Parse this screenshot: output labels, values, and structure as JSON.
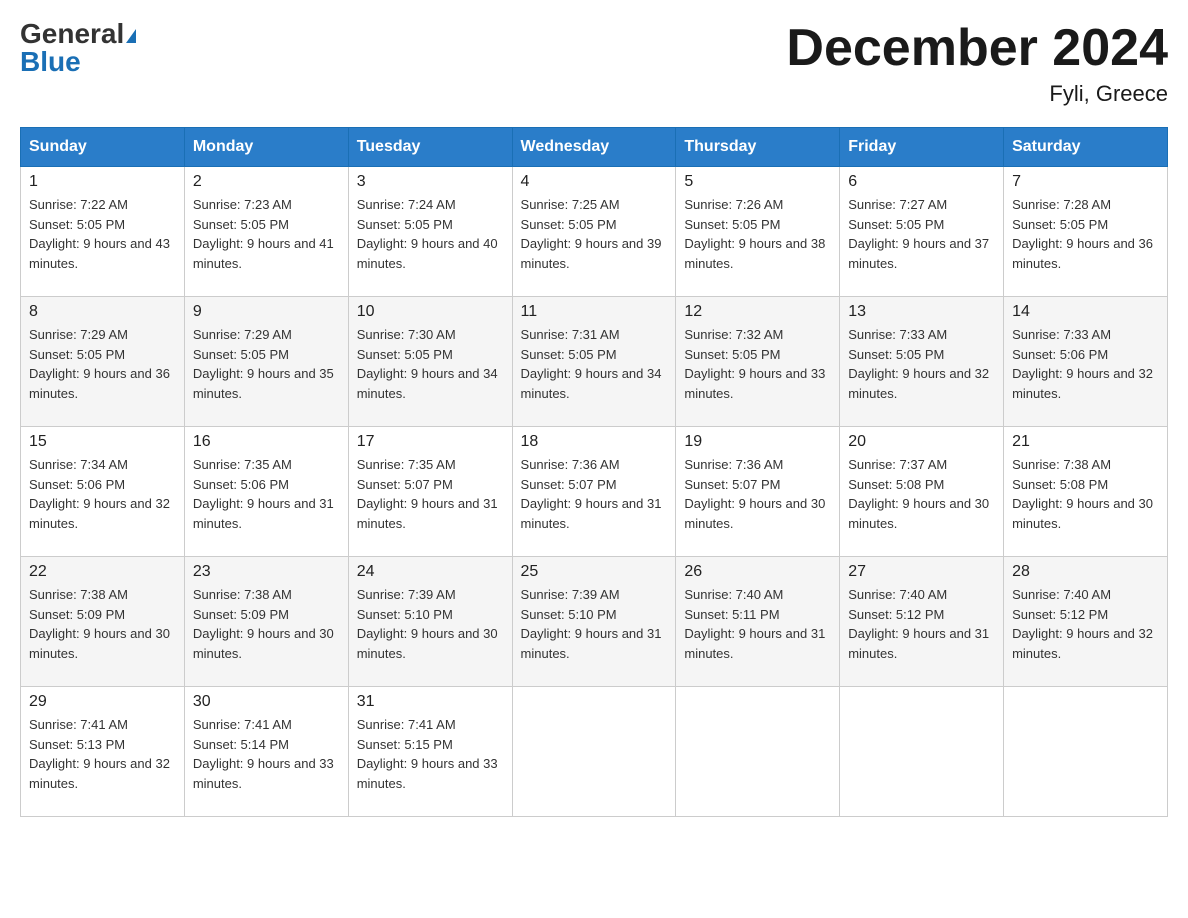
{
  "header": {
    "logo_general": "General",
    "logo_blue": "Blue",
    "month_title": "December 2024",
    "location": "Fyli, Greece"
  },
  "weekdays": [
    "Sunday",
    "Monday",
    "Tuesday",
    "Wednesday",
    "Thursday",
    "Friday",
    "Saturday"
  ],
  "weeks": [
    [
      {
        "day": "1",
        "sunrise": "7:22 AM",
        "sunset": "5:05 PM",
        "daylight": "9 hours and 43 minutes."
      },
      {
        "day": "2",
        "sunrise": "7:23 AM",
        "sunset": "5:05 PM",
        "daylight": "9 hours and 41 minutes."
      },
      {
        "day": "3",
        "sunrise": "7:24 AM",
        "sunset": "5:05 PM",
        "daylight": "9 hours and 40 minutes."
      },
      {
        "day": "4",
        "sunrise": "7:25 AM",
        "sunset": "5:05 PM",
        "daylight": "9 hours and 39 minutes."
      },
      {
        "day": "5",
        "sunrise": "7:26 AM",
        "sunset": "5:05 PM",
        "daylight": "9 hours and 38 minutes."
      },
      {
        "day": "6",
        "sunrise": "7:27 AM",
        "sunset": "5:05 PM",
        "daylight": "9 hours and 37 minutes."
      },
      {
        "day": "7",
        "sunrise": "7:28 AM",
        "sunset": "5:05 PM",
        "daylight": "9 hours and 36 minutes."
      }
    ],
    [
      {
        "day": "8",
        "sunrise": "7:29 AM",
        "sunset": "5:05 PM",
        "daylight": "9 hours and 36 minutes."
      },
      {
        "day": "9",
        "sunrise": "7:29 AM",
        "sunset": "5:05 PM",
        "daylight": "9 hours and 35 minutes."
      },
      {
        "day": "10",
        "sunrise": "7:30 AM",
        "sunset": "5:05 PM",
        "daylight": "9 hours and 34 minutes."
      },
      {
        "day": "11",
        "sunrise": "7:31 AM",
        "sunset": "5:05 PM",
        "daylight": "9 hours and 34 minutes."
      },
      {
        "day": "12",
        "sunrise": "7:32 AM",
        "sunset": "5:05 PM",
        "daylight": "9 hours and 33 minutes."
      },
      {
        "day": "13",
        "sunrise": "7:33 AM",
        "sunset": "5:05 PM",
        "daylight": "9 hours and 32 minutes."
      },
      {
        "day": "14",
        "sunrise": "7:33 AM",
        "sunset": "5:06 PM",
        "daylight": "9 hours and 32 minutes."
      }
    ],
    [
      {
        "day": "15",
        "sunrise": "7:34 AM",
        "sunset": "5:06 PM",
        "daylight": "9 hours and 32 minutes."
      },
      {
        "day": "16",
        "sunrise": "7:35 AM",
        "sunset": "5:06 PM",
        "daylight": "9 hours and 31 minutes."
      },
      {
        "day": "17",
        "sunrise": "7:35 AM",
        "sunset": "5:07 PM",
        "daylight": "9 hours and 31 minutes."
      },
      {
        "day": "18",
        "sunrise": "7:36 AM",
        "sunset": "5:07 PM",
        "daylight": "9 hours and 31 minutes."
      },
      {
        "day": "19",
        "sunrise": "7:36 AM",
        "sunset": "5:07 PM",
        "daylight": "9 hours and 30 minutes."
      },
      {
        "day": "20",
        "sunrise": "7:37 AM",
        "sunset": "5:08 PM",
        "daylight": "9 hours and 30 minutes."
      },
      {
        "day": "21",
        "sunrise": "7:38 AM",
        "sunset": "5:08 PM",
        "daylight": "9 hours and 30 minutes."
      }
    ],
    [
      {
        "day": "22",
        "sunrise": "7:38 AM",
        "sunset": "5:09 PM",
        "daylight": "9 hours and 30 minutes."
      },
      {
        "day": "23",
        "sunrise": "7:38 AM",
        "sunset": "5:09 PM",
        "daylight": "9 hours and 30 minutes."
      },
      {
        "day": "24",
        "sunrise": "7:39 AM",
        "sunset": "5:10 PM",
        "daylight": "9 hours and 30 minutes."
      },
      {
        "day": "25",
        "sunrise": "7:39 AM",
        "sunset": "5:10 PM",
        "daylight": "9 hours and 31 minutes."
      },
      {
        "day": "26",
        "sunrise": "7:40 AM",
        "sunset": "5:11 PM",
        "daylight": "9 hours and 31 minutes."
      },
      {
        "day": "27",
        "sunrise": "7:40 AM",
        "sunset": "5:12 PM",
        "daylight": "9 hours and 31 minutes."
      },
      {
        "day": "28",
        "sunrise": "7:40 AM",
        "sunset": "5:12 PM",
        "daylight": "9 hours and 32 minutes."
      }
    ],
    [
      {
        "day": "29",
        "sunrise": "7:41 AM",
        "sunset": "5:13 PM",
        "daylight": "9 hours and 32 minutes."
      },
      {
        "day": "30",
        "sunrise": "7:41 AM",
        "sunset": "5:14 PM",
        "daylight": "9 hours and 33 minutes."
      },
      {
        "day": "31",
        "sunrise": "7:41 AM",
        "sunset": "5:15 PM",
        "daylight": "9 hours and 33 minutes."
      },
      null,
      null,
      null,
      null
    ]
  ]
}
